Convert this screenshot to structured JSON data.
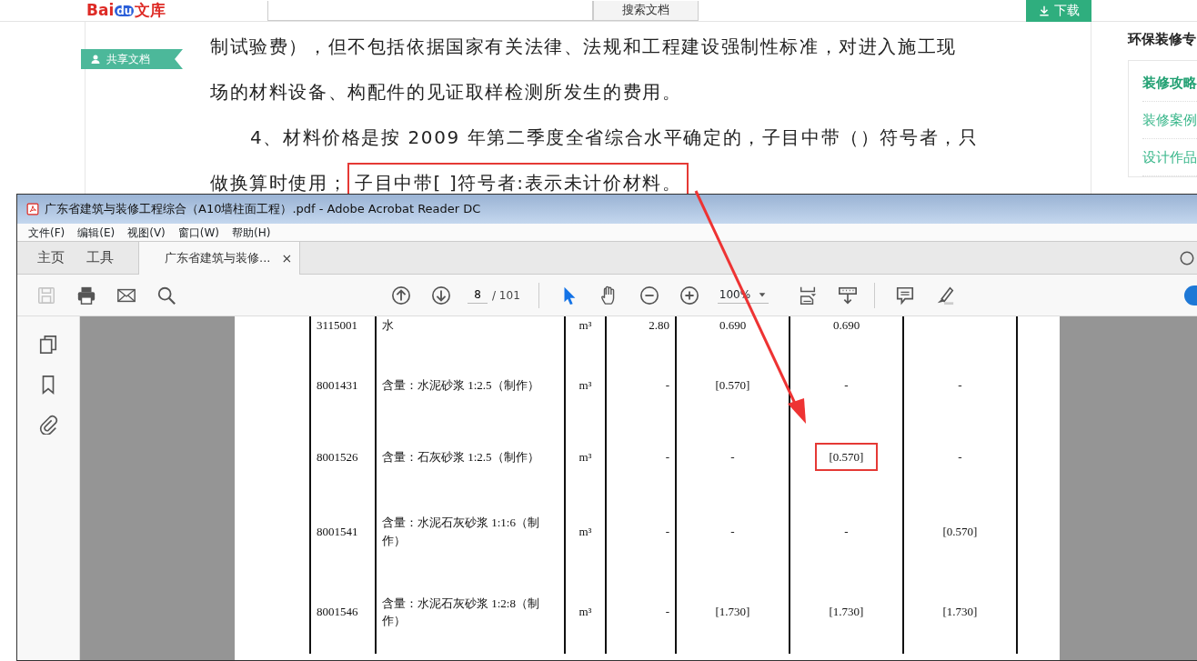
{
  "header": {
    "logo": [
      "Bai",
      "du",
      "文库"
    ],
    "search_button": "搜索文档",
    "download_button": "下载"
  },
  "doc": {
    "tag": "共享文档",
    "lines": [
      {
        "text": "制试验费），但不包括依据国家有关法律、法规和工程建设强制性标准，对进入施工现",
        "indent": false
      },
      {
        "text": "场的材料设备、构配件的见证取样检测所发生的费用。",
        "indent": false
      },
      {
        "text": "4、材料价格是按 2009 年第二季度全省综合水平确定的，子目中带（）符号者，只",
        "indent": true
      },
      {
        "text": "做换算时使用；",
        "indent": false,
        "highlight": "子目中带[ ]符号者:表示未计价材料。"
      }
    ]
  },
  "sidebar": {
    "title": "环保装修专",
    "links": [
      {
        "label": "装修攻略",
        "selected": true
      },
      {
        "label": "装修案例",
        "selected": false
      },
      {
        "label": "设计作品",
        "selected": false
      }
    ]
  },
  "reader": {
    "title": "广东省建筑与装修工程综合（A10墙柱面工程）.pdf - Adobe Acrobat Reader DC",
    "menu": [
      "文件(F)",
      "编辑(E)",
      "视图(V)",
      "窗口(W)",
      "帮助(H)"
    ],
    "tabs": [
      {
        "label": "主页",
        "selected": false
      },
      {
        "label": "工具",
        "selected": false
      },
      {
        "label": "广东省建筑与装修...",
        "selected": true,
        "close": "×"
      }
    ],
    "tools": [
      {
        "kind": "save",
        "disabled": true
      },
      {
        "kind": "print",
        "disabled": false
      },
      {
        "kind": "mail",
        "disabled": false
      },
      {
        "kind": "search",
        "disabled": false
      },
      {
        "kind": "up",
        "disabled": false
      },
      {
        "kind": "down",
        "disabled": false
      }
    ],
    "page": "8",
    "page_total": "/ 101",
    "pointer_tools": [
      {
        "kind": "select",
        "selected": true
      },
      {
        "kind": "hand",
        "selected": false
      }
    ],
    "zoom_tools": [
      {
        "kind": "zoomout"
      },
      {
        "kind": "zoomin"
      }
    ],
    "zoom": "100%",
    "view_tools": [
      {
        "kind": "fit"
      },
      {
        "kind": "scroll"
      },
      {
        "kind": "comment"
      },
      {
        "kind": "highlight"
      }
    ],
    "table": {
      "rows": [
        [
          "3115001",
          "水",
          "m³",
          "2.80",
          "0.690",
          "0.690"
        ],
        [
          "8001431",
          "含量：水泥砂浆 1:2.5（制作）",
          "m³",
          "-",
          "[0.570]",
          "-",
          "-"
        ],
        [
          "8001526",
          "含量：石灰砂浆 1:2.5（制作）",
          "m³",
          "-",
          "-",
          {
            "text": "[0.570]",
            "boxed": true
          },
          "-"
        ],
        [
          "8001541",
          "含量：水泥石灰砂浆 1:1:6（制作）",
          "m³",
          "-",
          "-",
          "-",
          "[0.570]"
        ],
        [
          "8001546",
          "含量：水泥石灰砂浆 1:2:8（制作）",
          "m³",
          "-",
          "[1.730]",
          "[1.730]",
          "[1.730]"
        ]
      ]
    }
  }
}
